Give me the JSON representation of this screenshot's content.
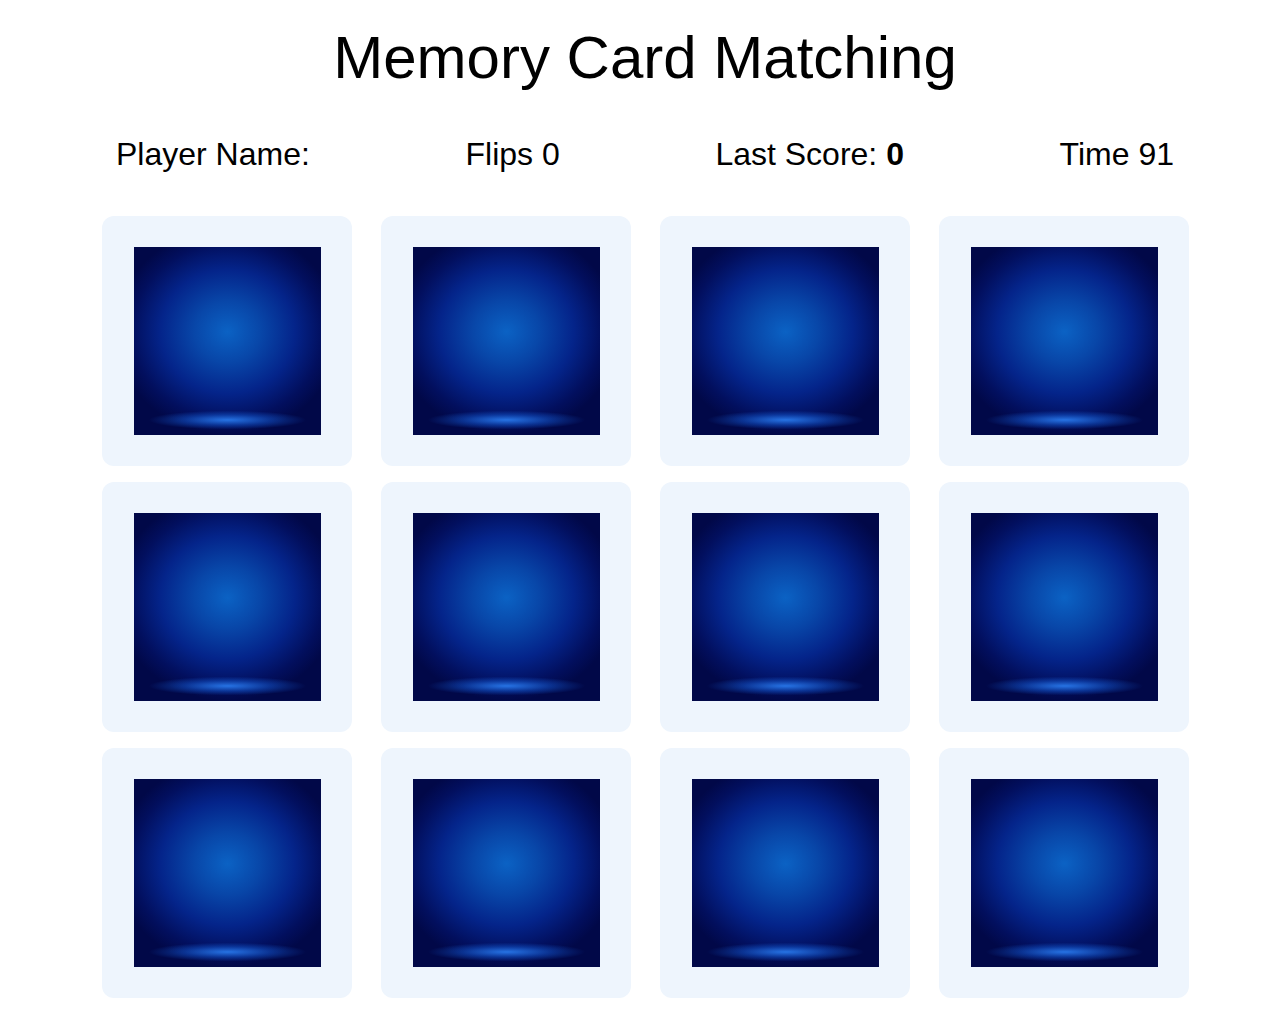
{
  "title": "Memory Card Matching",
  "stats": {
    "player": {
      "label": "Player Name:"
    },
    "flips": {
      "label": "Flips",
      "value": "0"
    },
    "last_score": {
      "label": "Last Score:",
      "value": "0"
    },
    "time": {
      "label": "Time",
      "value": "91"
    }
  },
  "cards": [
    {
      "face_up": false
    },
    {
      "face_up": false
    },
    {
      "face_up": false
    },
    {
      "face_up": false
    },
    {
      "face_up": false
    },
    {
      "face_up": false
    },
    {
      "face_up": false
    },
    {
      "face_up": false
    },
    {
      "face_up": false
    },
    {
      "face_up": false
    },
    {
      "face_up": false
    },
    {
      "face_up": false
    },
    {
      "face_up": false
    },
    {
      "face_up": false
    },
    {
      "face_up": false
    },
    {
      "face_up": false
    }
  ]
}
